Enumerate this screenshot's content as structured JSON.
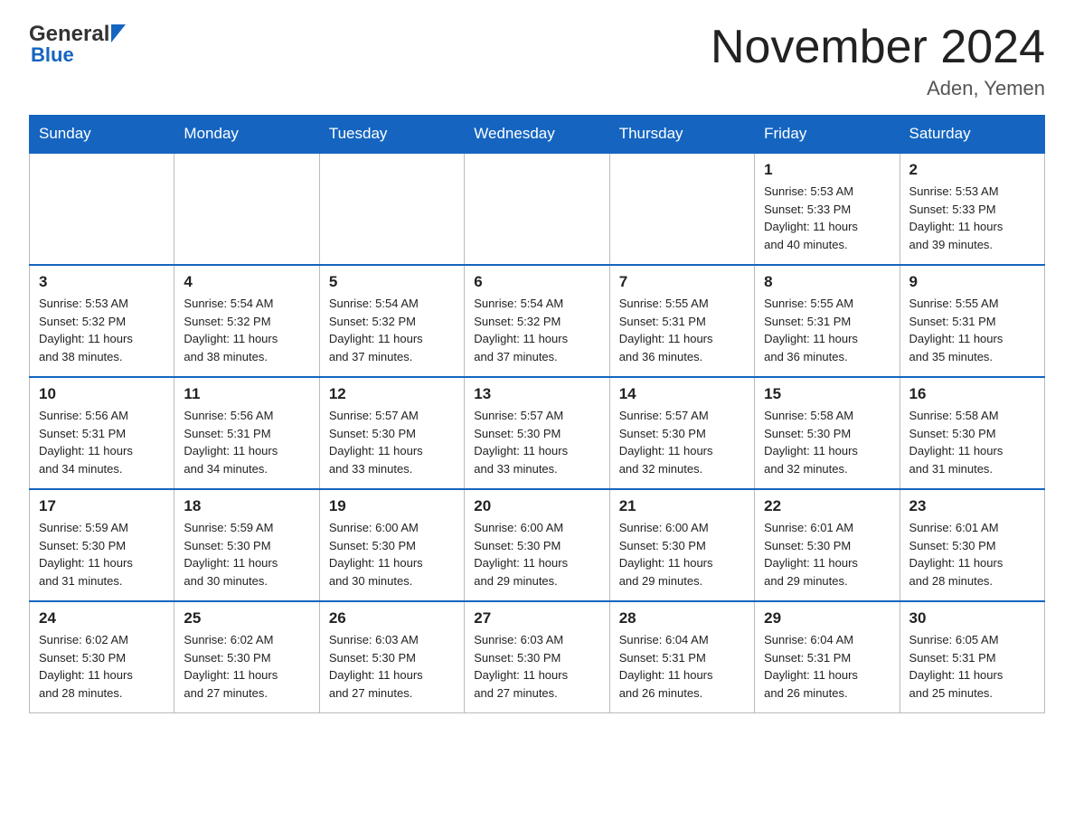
{
  "header": {
    "logo_general": "General",
    "logo_blue": "Blue",
    "title": "November 2024",
    "subtitle": "Aden, Yemen"
  },
  "days_of_week": [
    "Sunday",
    "Monday",
    "Tuesday",
    "Wednesday",
    "Thursday",
    "Friday",
    "Saturday"
  ],
  "weeks": [
    [
      {
        "day": "",
        "info": ""
      },
      {
        "day": "",
        "info": ""
      },
      {
        "day": "",
        "info": ""
      },
      {
        "day": "",
        "info": ""
      },
      {
        "day": "",
        "info": ""
      },
      {
        "day": "1",
        "info": "Sunrise: 5:53 AM\nSunset: 5:33 PM\nDaylight: 11 hours\nand 40 minutes."
      },
      {
        "day": "2",
        "info": "Sunrise: 5:53 AM\nSunset: 5:33 PM\nDaylight: 11 hours\nand 39 minutes."
      }
    ],
    [
      {
        "day": "3",
        "info": "Sunrise: 5:53 AM\nSunset: 5:32 PM\nDaylight: 11 hours\nand 38 minutes."
      },
      {
        "day": "4",
        "info": "Sunrise: 5:54 AM\nSunset: 5:32 PM\nDaylight: 11 hours\nand 38 minutes."
      },
      {
        "day": "5",
        "info": "Sunrise: 5:54 AM\nSunset: 5:32 PM\nDaylight: 11 hours\nand 37 minutes."
      },
      {
        "day": "6",
        "info": "Sunrise: 5:54 AM\nSunset: 5:32 PM\nDaylight: 11 hours\nand 37 minutes."
      },
      {
        "day": "7",
        "info": "Sunrise: 5:55 AM\nSunset: 5:31 PM\nDaylight: 11 hours\nand 36 minutes."
      },
      {
        "day": "8",
        "info": "Sunrise: 5:55 AM\nSunset: 5:31 PM\nDaylight: 11 hours\nand 36 minutes."
      },
      {
        "day": "9",
        "info": "Sunrise: 5:55 AM\nSunset: 5:31 PM\nDaylight: 11 hours\nand 35 minutes."
      }
    ],
    [
      {
        "day": "10",
        "info": "Sunrise: 5:56 AM\nSunset: 5:31 PM\nDaylight: 11 hours\nand 34 minutes."
      },
      {
        "day": "11",
        "info": "Sunrise: 5:56 AM\nSunset: 5:31 PM\nDaylight: 11 hours\nand 34 minutes."
      },
      {
        "day": "12",
        "info": "Sunrise: 5:57 AM\nSunset: 5:30 PM\nDaylight: 11 hours\nand 33 minutes."
      },
      {
        "day": "13",
        "info": "Sunrise: 5:57 AM\nSunset: 5:30 PM\nDaylight: 11 hours\nand 33 minutes."
      },
      {
        "day": "14",
        "info": "Sunrise: 5:57 AM\nSunset: 5:30 PM\nDaylight: 11 hours\nand 32 minutes."
      },
      {
        "day": "15",
        "info": "Sunrise: 5:58 AM\nSunset: 5:30 PM\nDaylight: 11 hours\nand 32 minutes."
      },
      {
        "day": "16",
        "info": "Sunrise: 5:58 AM\nSunset: 5:30 PM\nDaylight: 11 hours\nand 31 minutes."
      }
    ],
    [
      {
        "day": "17",
        "info": "Sunrise: 5:59 AM\nSunset: 5:30 PM\nDaylight: 11 hours\nand 31 minutes."
      },
      {
        "day": "18",
        "info": "Sunrise: 5:59 AM\nSunset: 5:30 PM\nDaylight: 11 hours\nand 30 minutes."
      },
      {
        "day": "19",
        "info": "Sunrise: 6:00 AM\nSunset: 5:30 PM\nDaylight: 11 hours\nand 30 minutes."
      },
      {
        "day": "20",
        "info": "Sunrise: 6:00 AM\nSunset: 5:30 PM\nDaylight: 11 hours\nand 29 minutes."
      },
      {
        "day": "21",
        "info": "Sunrise: 6:00 AM\nSunset: 5:30 PM\nDaylight: 11 hours\nand 29 minutes."
      },
      {
        "day": "22",
        "info": "Sunrise: 6:01 AM\nSunset: 5:30 PM\nDaylight: 11 hours\nand 29 minutes."
      },
      {
        "day": "23",
        "info": "Sunrise: 6:01 AM\nSunset: 5:30 PM\nDaylight: 11 hours\nand 28 minutes."
      }
    ],
    [
      {
        "day": "24",
        "info": "Sunrise: 6:02 AM\nSunset: 5:30 PM\nDaylight: 11 hours\nand 28 minutes."
      },
      {
        "day": "25",
        "info": "Sunrise: 6:02 AM\nSunset: 5:30 PM\nDaylight: 11 hours\nand 27 minutes."
      },
      {
        "day": "26",
        "info": "Sunrise: 6:03 AM\nSunset: 5:30 PM\nDaylight: 11 hours\nand 27 minutes."
      },
      {
        "day": "27",
        "info": "Sunrise: 6:03 AM\nSunset: 5:30 PM\nDaylight: 11 hours\nand 27 minutes."
      },
      {
        "day": "28",
        "info": "Sunrise: 6:04 AM\nSunset: 5:31 PM\nDaylight: 11 hours\nand 26 minutes."
      },
      {
        "day": "29",
        "info": "Sunrise: 6:04 AM\nSunset: 5:31 PM\nDaylight: 11 hours\nand 26 minutes."
      },
      {
        "day": "30",
        "info": "Sunrise: 6:05 AM\nSunset: 5:31 PM\nDaylight: 11 hours\nand 25 minutes."
      }
    ]
  ]
}
